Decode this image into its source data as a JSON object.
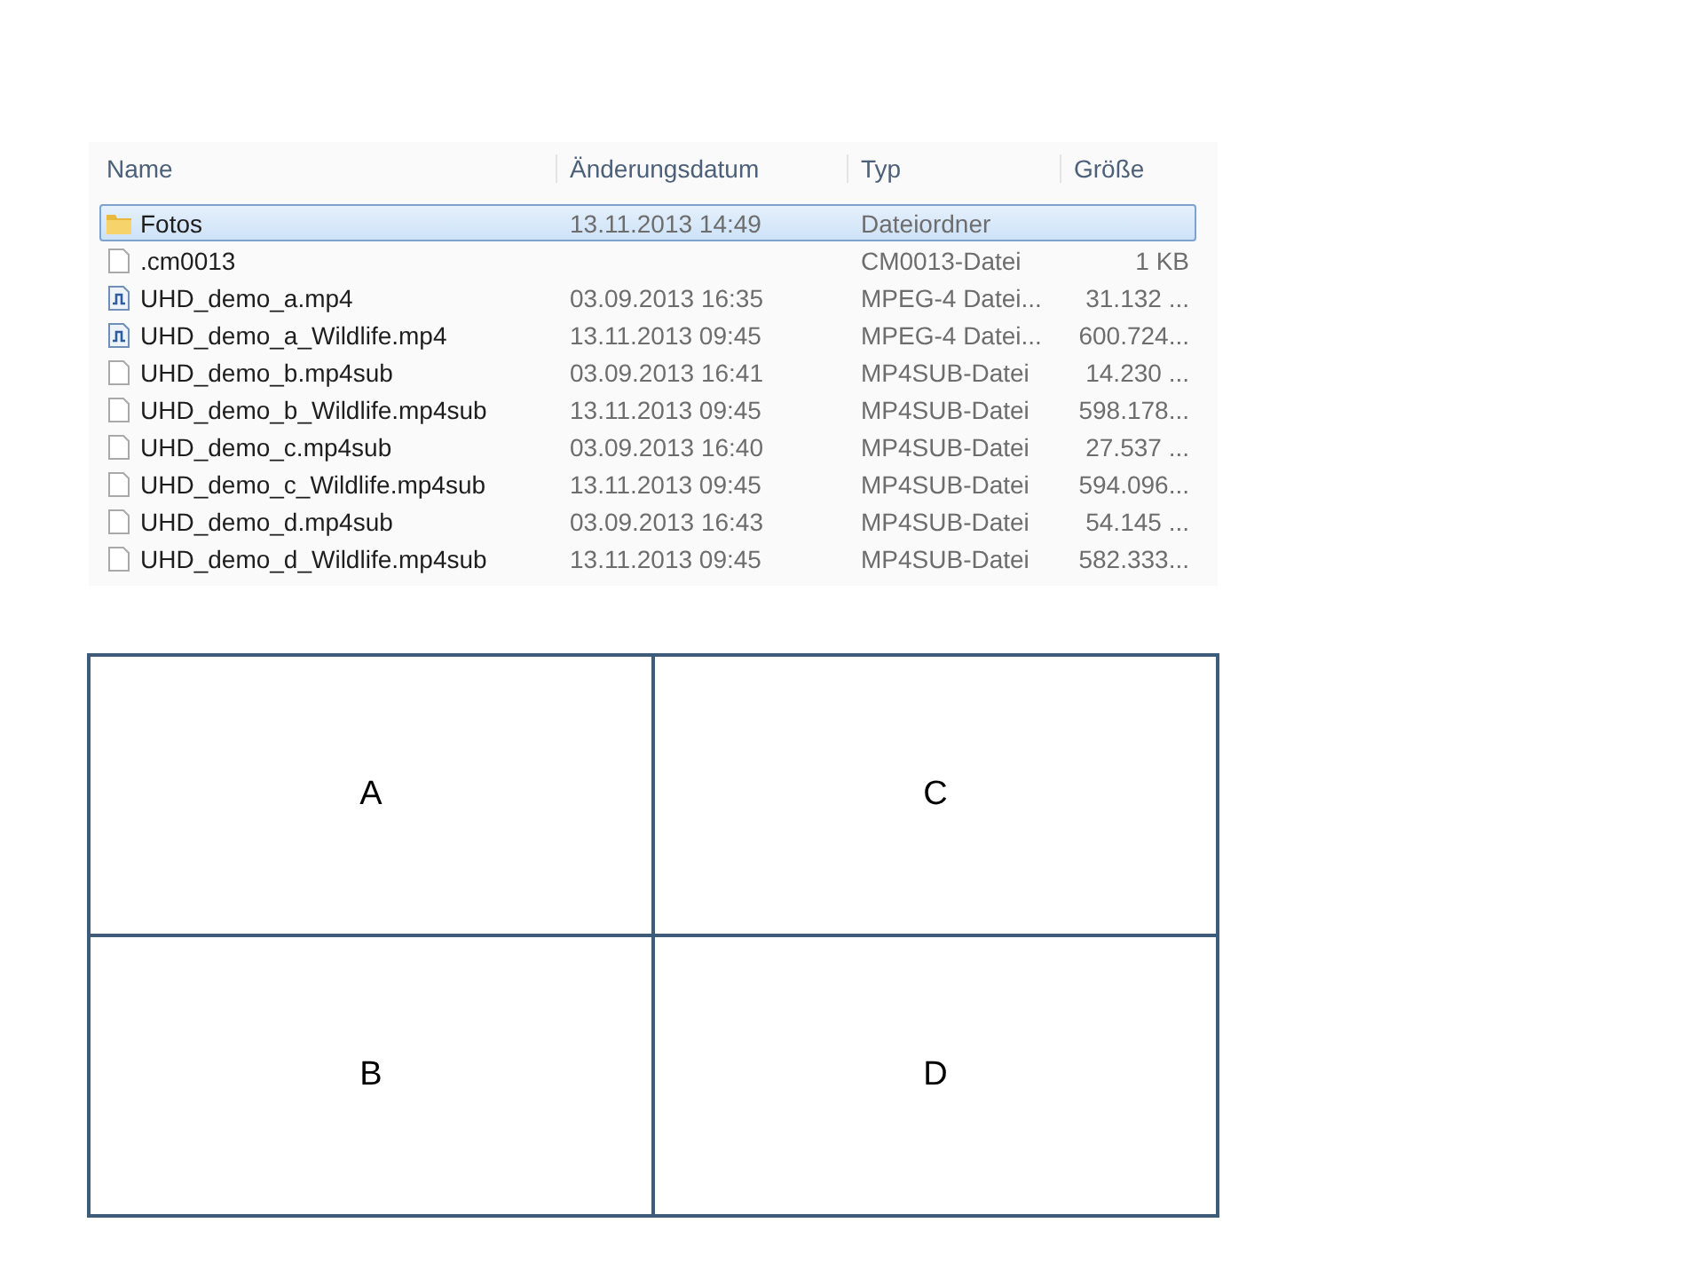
{
  "file_list": {
    "columns": [
      "Name",
      "Änderungsdatum",
      "Typ",
      "Größe"
    ],
    "rows": [
      {
        "kind": "folder",
        "selected": true,
        "name": "Fotos",
        "date": "13.11.2013 14:49",
        "type": "Dateiordner",
        "size": ""
      },
      {
        "kind": "file",
        "selected": false,
        "name": ".cm0013",
        "date": "",
        "type": "CM0013-Datei",
        "size": "1 KB"
      },
      {
        "kind": "video",
        "selected": false,
        "name": "UHD_demo_a.mp4",
        "date": "03.09.2013 16:35",
        "type": "MPEG-4 Datei...",
        "size": "31.132 ..."
      },
      {
        "kind": "video",
        "selected": false,
        "name": "UHD_demo_a_Wildlife.mp4",
        "date": "13.11.2013 09:45",
        "type": "MPEG-4 Datei...",
        "size": "600.724..."
      },
      {
        "kind": "file",
        "selected": false,
        "name": "UHD_demo_b.mp4sub",
        "date": "03.09.2013 16:41",
        "type": "MP4SUB-Datei",
        "size": "14.230 ..."
      },
      {
        "kind": "file",
        "selected": false,
        "name": "UHD_demo_b_Wildlife.mp4sub",
        "date": "13.11.2013 09:45",
        "type": "MP4SUB-Datei",
        "size": "598.178..."
      },
      {
        "kind": "file",
        "selected": false,
        "name": "UHD_demo_c.mp4sub",
        "date": "03.09.2013 16:40",
        "type": "MP4SUB-Datei",
        "size": "27.537 ..."
      },
      {
        "kind": "file",
        "selected": false,
        "name": "UHD_demo_c_Wildlife.mp4sub",
        "date": "13.11.2013 09:45",
        "type": "MP4SUB-Datei",
        "size": "594.096..."
      },
      {
        "kind": "file",
        "selected": false,
        "name": "UHD_demo_d.mp4sub",
        "date": "03.09.2013 16:43",
        "type": "MP4SUB-Datei",
        "size": "54.145 ..."
      },
      {
        "kind": "file",
        "selected": false,
        "name": "UHD_demo_d_Wildlife.mp4sub",
        "date": "13.11.2013 09:45",
        "type": "MP4SUB-Datei",
        "size": "582.333..."
      }
    ]
  },
  "quadrants": [
    "A",
    "C",
    "B",
    "D"
  ]
}
